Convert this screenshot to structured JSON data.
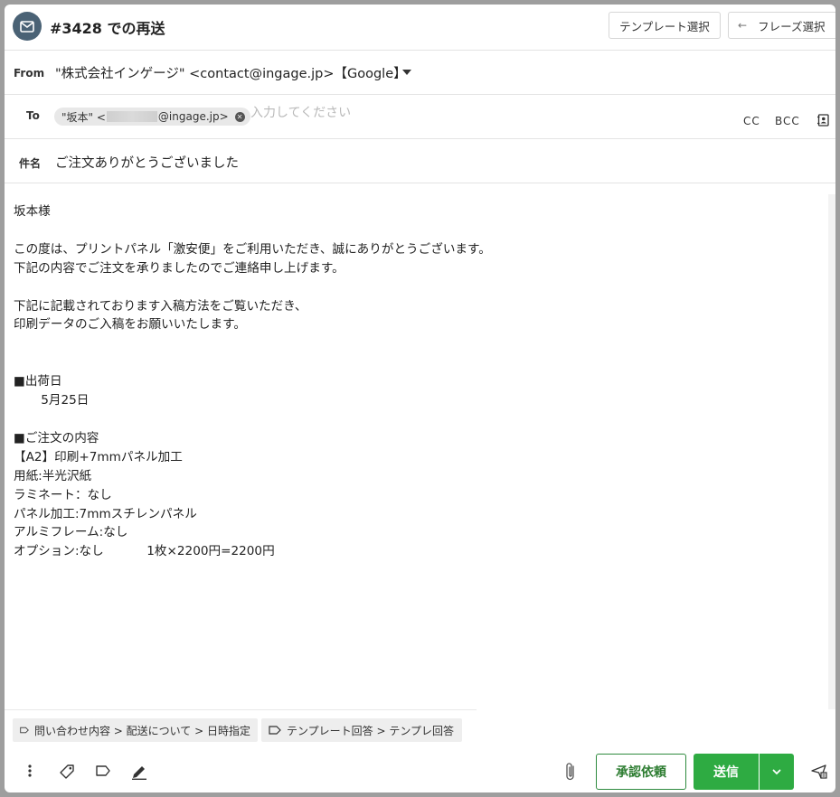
{
  "header": {
    "title": "#3428 での再送",
    "template_button": "テンプレート選択",
    "phrase_button": "フレーズ選択",
    "phrase_arrow": "←"
  },
  "from": {
    "label": "From",
    "value": "\"株式会社インゲージ\" <contact@ingage.jp>【Google】"
  },
  "to": {
    "label": "To",
    "recipient_prefix": "\"坂本\" <",
    "recipient_suffix": "@ingage.jp>",
    "placeholder": "入力してください",
    "cc_label": "CC",
    "bcc_label": "BCC"
  },
  "subject": {
    "label": "件名",
    "value": "ご注文ありがとうございました"
  },
  "body": {
    "text": "坂本様\n\nこの度は、プリントパネル「激安便」をご利用いただき、誠にありがとうございます。\n下記の内容でご注文を承りましたのでご連絡申し上げます。\n\n下記に記載されております入稿方法をご覧いただき、\n印刷データのご入稿をお願いいたします。\n\n\n■出荷日\n       5月25日\n\n■ご注文の内容\n【A2】印刷+7mmパネル加工\n用紙:半光沢紙\nラミネート：なし\nパネル加工:7mmスチレンパネル\nアルミフレーム:なし\nオプション:なし           1枚×2200円=2200円"
  },
  "tags": [
    {
      "label": "問い合わせ内容 > 配送について > 日時指定"
    },
    {
      "label": "テンプレート回答 > テンプレ回答"
    }
  ],
  "footer": {
    "approval_button": "承認依頼",
    "send_button": "送信"
  },
  "colors": {
    "send_green": "#2eab42",
    "approval_border": "#2e8b3e",
    "mail_icon_bg": "#4a6275"
  },
  "icons": [
    "mail-icon",
    "chevron-down-icon",
    "close-circle-icon",
    "address-book-icon",
    "tag-icon",
    "more-vertical-icon",
    "label-icon",
    "pen-icon",
    "paperclip-icon",
    "send-later-icon"
  ]
}
